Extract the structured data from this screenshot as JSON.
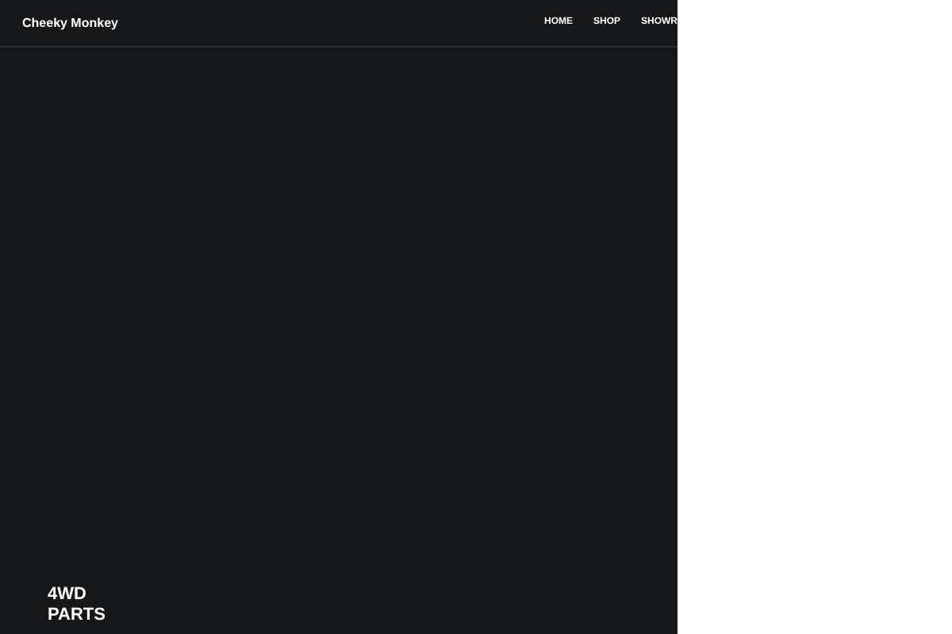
{
  "header": {
    "brand": "Cheeky Monkey",
    "nav": [
      {
        "label": "HOME"
      },
      {
        "label": "SHOP"
      },
      {
        "label": "SHOWR"
      }
    ]
  },
  "hero": {
    "heading_lines": [
      "4WD",
      "PARTS"
    ]
  }
}
